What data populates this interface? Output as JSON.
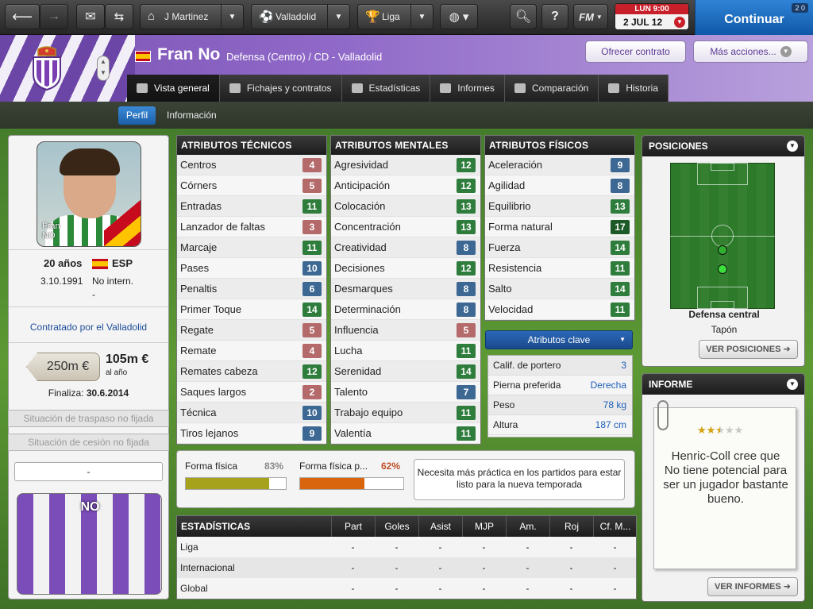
{
  "topbar": {
    "manager": "J Martinez",
    "club": "Valladolid",
    "league": "Liga",
    "fm_label": "FM",
    "date_day": "LUN 9:00",
    "date_main": "2 JUL 12",
    "continue_label": "Continuar",
    "continue_badge": "2 0"
  },
  "header": {
    "player_name": "Fran No",
    "position_club": "Defensa (Centro) / CD - Valladolid",
    "offer_btn": "Ofrecer contrato",
    "more_btn": "Más acciones..."
  },
  "tabs": [
    {
      "label": "Vista general"
    },
    {
      "label": "Fichajes y contratos"
    },
    {
      "label": "Estadísticas"
    },
    {
      "label": "Informes"
    },
    {
      "label": "Comparación"
    },
    {
      "label": "Historia"
    }
  ],
  "subtabs": {
    "perfil": "Perfil",
    "info": "Información"
  },
  "profile": {
    "photo_caption_line1": "Fran",
    "photo_caption_line2": "NO",
    "age": "20 años",
    "nationality": "ESP",
    "dob": "3.10.1991",
    "international": "No intern.",
    "international_extra": "-",
    "contracted": "Contratado por el Valladolid",
    "value": "250m €",
    "wage": "105m €",
    "wage_period": "al año",
    "contract_end_label": "Finaliza:",
    "contract_end": "30.6.2014",
    "transfer_status": "Situación de traspaso no fijada",
    "loan_status": "Situación de cesión no fijada",
    "dash": "-",
    "kit_name": "NO"
  },
  "technical": {
    "title": "ATRIBUTOS TÉCNICOS",
    "rows": [
      {
        "name": "Centros",
        "value": "4",
        "color": "red"
      },
      {
        "name": "Córners",
        "value": "5",
        "color": "red"
      },
      {
        "name": "Entradas",
        "value": "11",
        "color": "green"
      },
      {
        "name": "Lanzador de faltas",
        "value": "3",
        "color": "red"
      },
      {
        "name": "Marcaje",
        "value": "11",
        "color": "green"
      },
      {
        "name": "Pases",
        "value": "10",
        "color": "blue"
      },
      {
        "name": "Penaltis",
        "value": "6",
        "color": "blue"
      },
      {
        "name": "Primer Toque",
        "value": "14",
        "color": "green"
      },
      {
        "name": "Regate",
        "value": "5",
        "color": "red"
      },
      {
        "name": "Remate",
        "value": "4",
        "color": "red"
      },
      {
        "name": "Remates cabeza",
        "value": "12",
        "color": "green"
      },
      {
        "name": "Saques largos",
        "value": "2",
        "color": "red"
      },
      {
        "name": "Técnica",
        "value": "10",
        "color": "blue"
      },
      {
        "name": "Tiros lejanos",
        "value": "9",
        "color": "blue"
      }
    ]
  },
  "mental": {
    "title": "ATRIBUTOS MENTALES",
    "rows": [
      {
        "name": "Agresividad",
        "value": "12",
        "color": "green"
      },
      {
        "name": "Anticipación",
        "value": "12",
        "color": "green"
      },
      {
        "name": "Colocación",
        "value": "13",
        "color": "green"
      },
      {
        "name": "Concentración",
        "value": "13",
        "color": "green"
      },
      {
        "name": "Creatividad",
        "value": "8",
        "color": "blue"
      },
      {
        "name": "Decisiones",
        "value": "12",
        "color": "green"
      },
      {
        "name": "Desmarques",
        "value": "8",
        "color": "blue"
      },
      {
        "name": "Determinación",
        "value": "8",
        "color": "blue"
      },
      {
        "name": "Influencia",
        "value": "5",
        "color": "red"
      },
      {
        "name": "Lucha",
        "value": "11",
        "color": "green"
      },
      {
        "name": "Serenidad",
        "value": "14",
        "color": "green"
      },
      {
        "name": "Talento",
        "value": "7",
        "color": "blue"
      },
      {
        "name": "Trabajo equipo",
        "value": "11",
        "color": "green"
      },
      {
        "name": "Valentía",
        "value": "11",
        "color": "green"
      }
    ]
  },
  "physical": {
    "title": "ATRIBUTOS FÍSICOS",
    "rows": [
      {
        "name": "Aceleración",
        "value": "9",
        "color": "blue"
      },
      {
        "name": "Agilidad",
        "value": "8",
        "color": "blue"
      },
      {
        "name": "Equilibrio",
        "value": "13",
        "color": "green"
      },
      {
        "name": "Forma natural",
        "value": "17",
        "color": "dkgreen"
      },
      {
        "name": "Fuerza",
        "value": "14",
        "color": "green"
      },
      {
        "name": "Resistencia",
        "value": "11",
        "color": "green"
      },
      {
        "name": "Salto",
        "value": "14",
        "color": "green"
      },
      {
        "name": "Velocidad",
        "value": "11",
        "color": "green"
      }
    ]
  },
  "key_attrs": {
    "title": "Atributos clave",
    "rows": [
      {
        "name": "Calif. de portero",
        "value": "3"
      },
      {
        "name": "Pierna preferida",
        "value": "Derecha"
      },
      {
        "name": "Peso",
        "value": "78 kg"
      },
      {
        "name": "Altura",
        "value": "187 cm"
      }
    ]
  },
  "fitness": {
    "condition_label": "Forma física",
    "condition_pct": "83%",
    "condition_level": 0.83,
    "match_label": "Forma física p...",
    "match_pct": "62%",
    "match_level": 0.62,
    "note": "Necesita más práctica en los partidos para estar listo para la nueva temporada",
    "condition_color": "#a7a21b",
    "match_color": "#d9650f"
  },
  "stats": {
    "title": "ESTADÍSTICAS",
    "columns": [
      "Part",
      "Goles",
      "Asist",
      "MJP",
      "Am.",
      "Roj",
      "Cf. M..."
    ],
    "rows": [
      {
        "name": "Liga",
        "values": [
          "-",
          "-",
          "-",
          "-",
          "-",
          "-",
          "-"
        ]
      },
      {
        "name": "Internacional",
        "values": [
          "-",
          "-",
          "-",
          "-",
          "-",
          "-",
          "-"
        ]
      },
      {
        "name": "Global",
        "values": [
          "-",
          "-",
          "-",
          "-",
          "-",
          "-",
          "-"
        ]
      }
    ]
  },
  "positions": {
    "title": "POSICIONES",
    "main": "Defensa central",
    "role": "Tapón",
    "button": "VER POSICIONES"
  },
  "report": {
    "title": "INFORME",
    "stars": "★★★★★",
    "stars_filled": 2.5,
    "stars_total": 5,
    "text": "Henric-Coll cree que No tiene potencial para ser un jugador bastante bueno.",
    "button": "VER INFORMES"
  }
}
